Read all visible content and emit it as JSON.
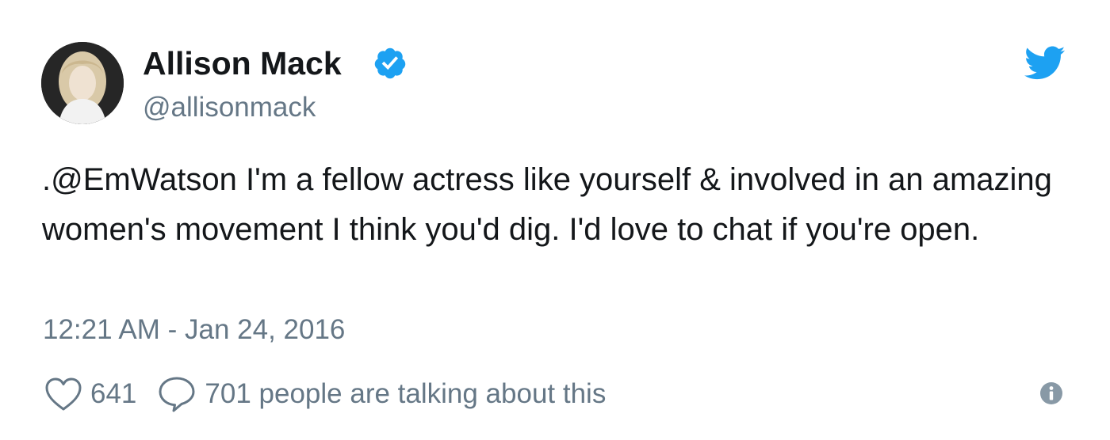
{
  "colors": {
    "text": "#14171a",
    "secondary": "#657786",
    "twitter_blue": "#1da1f2",
    "verified_blue": "#1da1f2"
  },
  "user": {
    "display_name": "Allison Mack",
    "handle": "@allisonmack",
    "verified": true,
    "avatar": "avatar-photo"
  },
  "tweet": {
    "text": ".@EmWatson I'm a fellow actress like yourself & involved in an amazing women's movement I think you'd dig. I'd love to chat if you're open.",
    "timestamp": "12:21 AM - Jan 24, 2016"
  },
  "actions": {
    "like_icon": "heart-icon",
    "like_count": "641",
    "reply_icon": "speech-bubble-icon",
    "talking_text": "701 people are talking about this",
    "info_icon": "info-icon"
  },
  "brand_icon": "twitter-bird-icon"
}
